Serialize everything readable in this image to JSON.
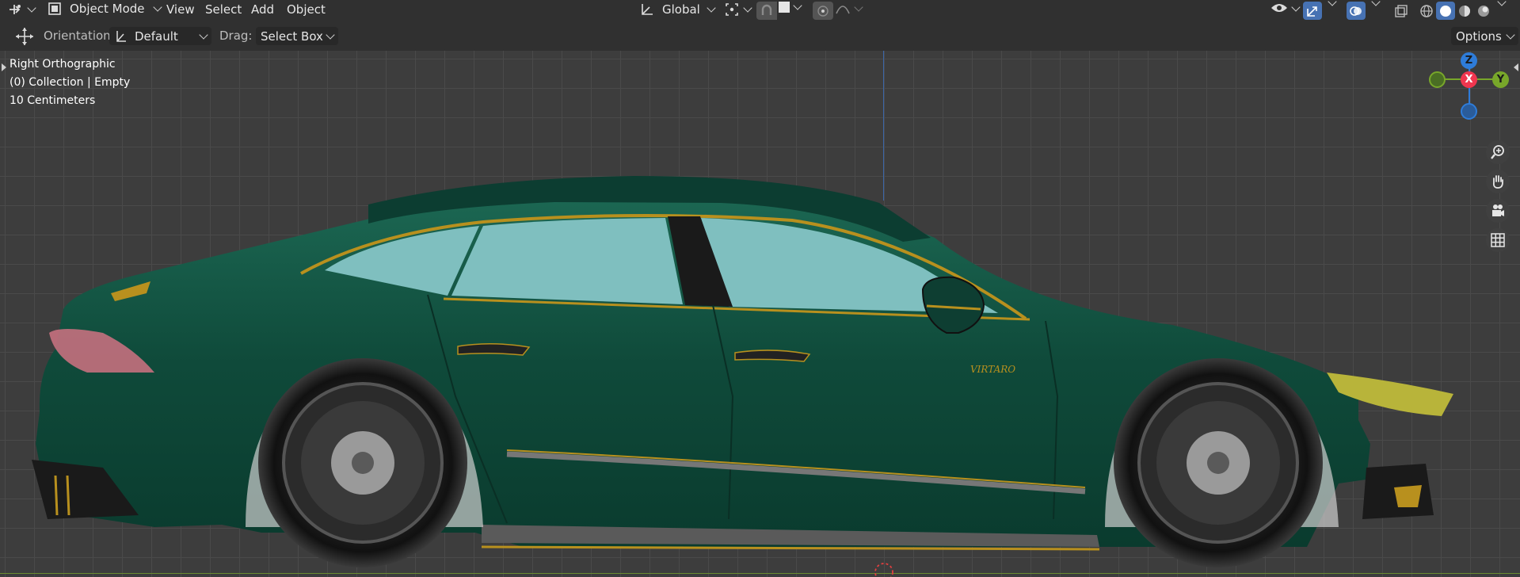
{
  "header": {
    "mode": "Object Mode",
    "menus": [
      "View",
      "Select",
      "Add",
      "Object"
    ],
    "transform_orientation": "Global"
  },
  "toolbar": {
    "orientation_label": "Orientation:",
    "orientation_value": "Default",
    "drag_label": "Drag:",
    "drag_value": "Select Box",
    "options": "Options"
  },
  "viewport": {
    "view_name": "Right Orthographic",
    "collection_info": "(0) Collection | Empty",
    "scale_info": "10 Centimeters"
  },
  "gizmo": {
    "z": "Z",
    "x": "X",
    "y": "Y",
    "colors": {
      "x": "#f0364f",
      "y": "#78a72a",
      "z": "#2e7cd9",
      "neg_z": "#2a5c9a"
    }
  },
  "car": {
    "body_color": "#0f4a3a",
    "trim_color": "#b8901e",
    "glass_color": "#7fbfbf",
    "badge_text": "VIRTARO"
  },
  "icons": [
    "editor-type-icon",
    "object-mode-icon",
    "transform-orientation-icon",
    "pivot-icon",
    "snap-icon",
    "proportional-icon",
    "move-tool-icon",
    "visibility-icon",
    "gizmo-icon",
    "overlay-icon",
    "xray-icon",
    "wireframe-icon",
    "solid-icon",
    "material-icon",
    "rendered-icon",
    "zoom-icon",
    "pan-icon",
    "camera-icon",
    "grid-icon"
  ]
}
